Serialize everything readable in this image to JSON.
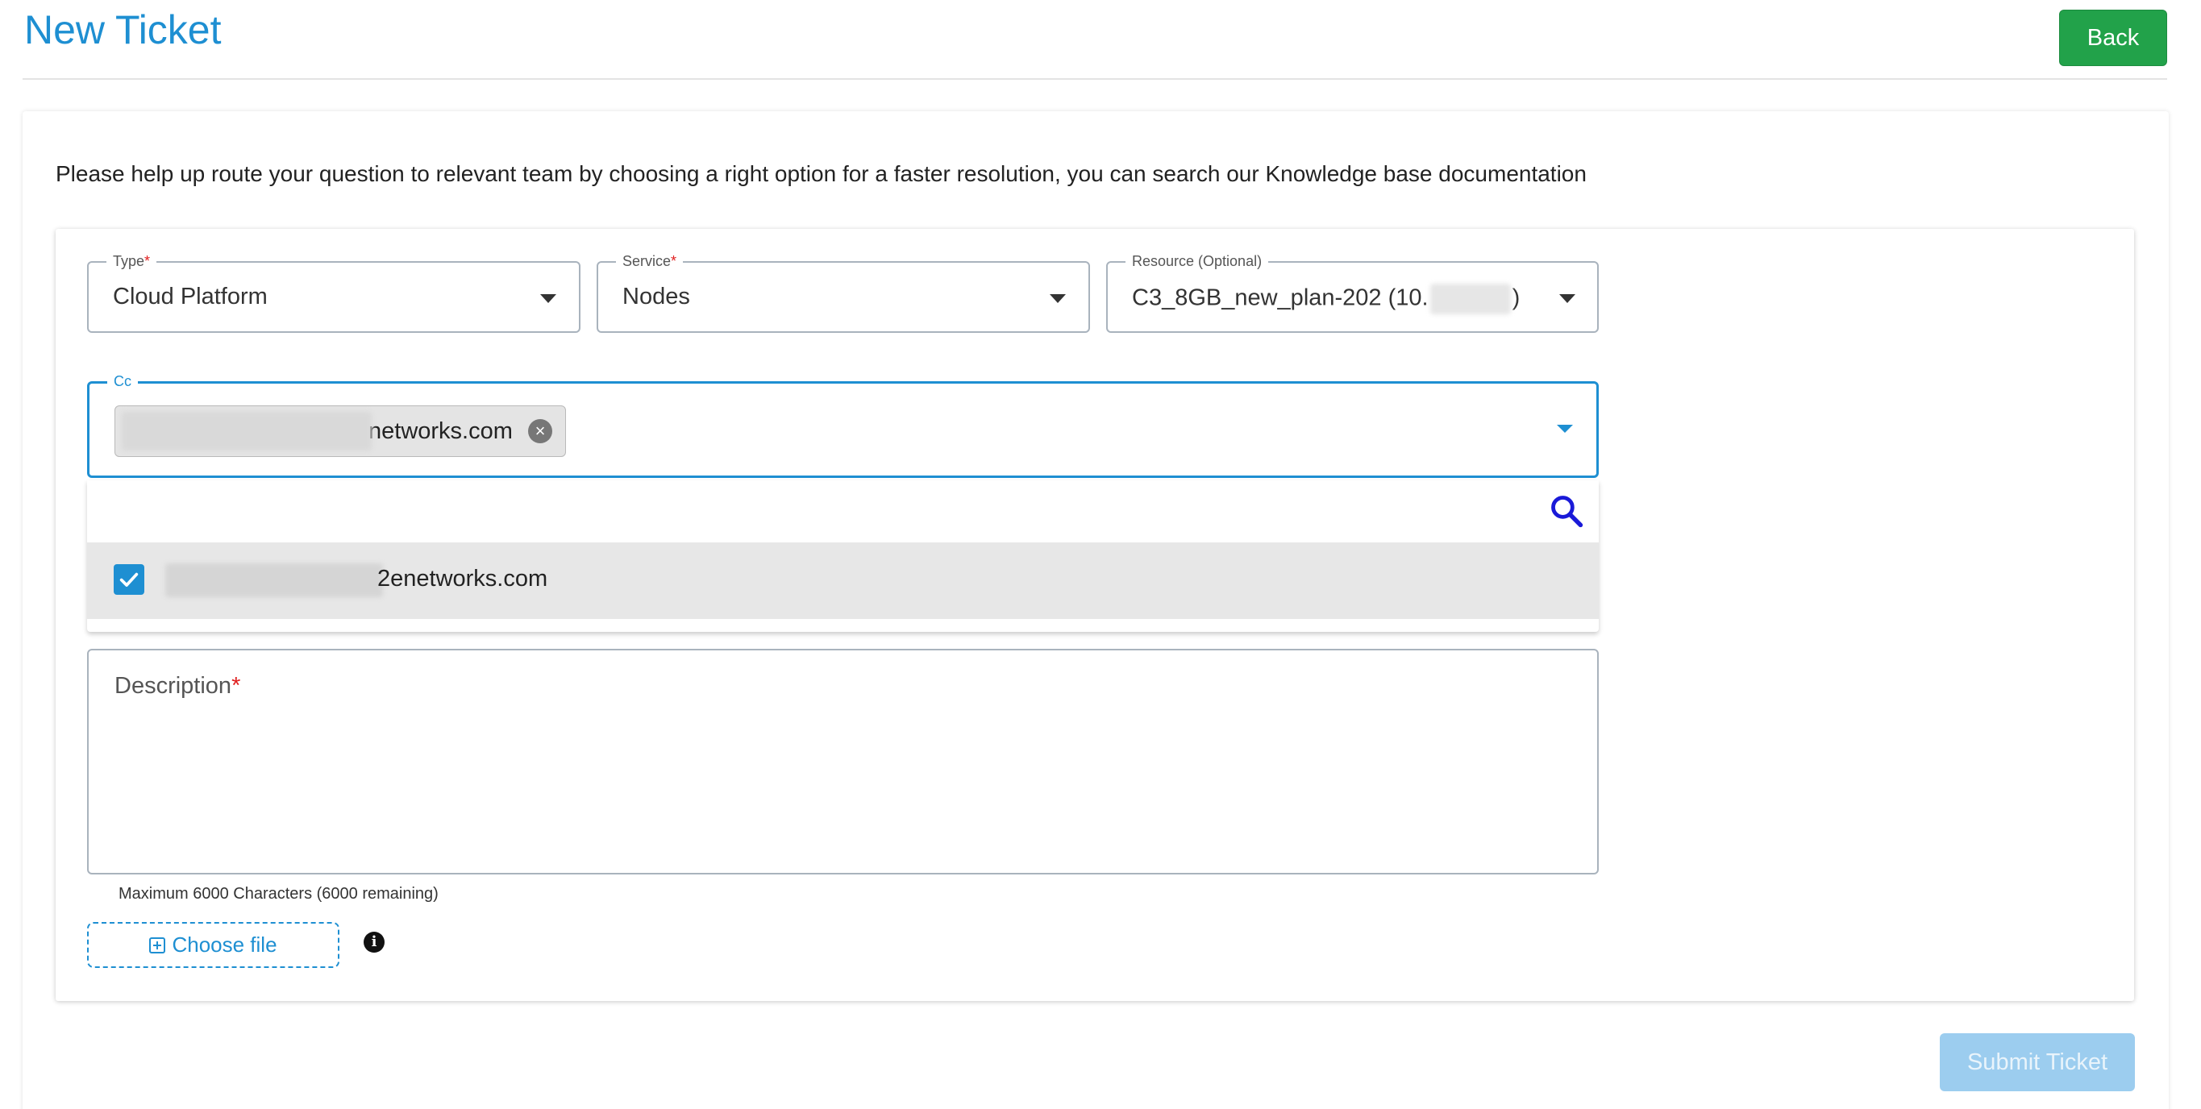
{
  "header": {
    "title": "New Ticket",
    "back_label": "Back"
  },
  "intro": "Please help up route your question to relevant team by choosing a right option for a faster resolution, you can search our Knowledge base documentation",
  "form": {
    "type": {
      "label": "Type",
      "required_mark": "*",
      "value": "Cloud Platform"
    },
    "service": {
      "label": "Service",
      "required_mark": "*",
      "value": "Nodes"
    },
    "resource": {
      "label": "Resource (Optional)",
      "value_prefix": "C3_8GB_new_plan-202 (10.",
      "value_suffix": ")"
    },
    "cc": {
      "label": "Cc",
      "chip_text": "networks.com",
      "options": [
        {
          "text": "2enetworks.com",
          "checked": true
        }
      ]
    },
    "description": {
      "label": "Description",
      "required_mark": "*"
    },
    "char_hint": "Maximum 6000 Characters (6000 remaining)",
    "choose_file_label": "Choose file",
    "info_glyph": "i"
  },
  "submit_label": "Submit Ticket",
  "colors": {
    "accent": "#1e8fd2",
    "back_button": "#22a24a",
    "submit_disabled": "#9ccdef",
    "required": "#e02020"
  },
  "icons": {
    "dropdown": "caret-down-icon",
    "remove_chip": "close-circle-icon",
    "search": "search-icon",
    "checkbox": "check-icon",
    "attach": "plus-square-icon",
    "info": "info-icon"
  }
}
